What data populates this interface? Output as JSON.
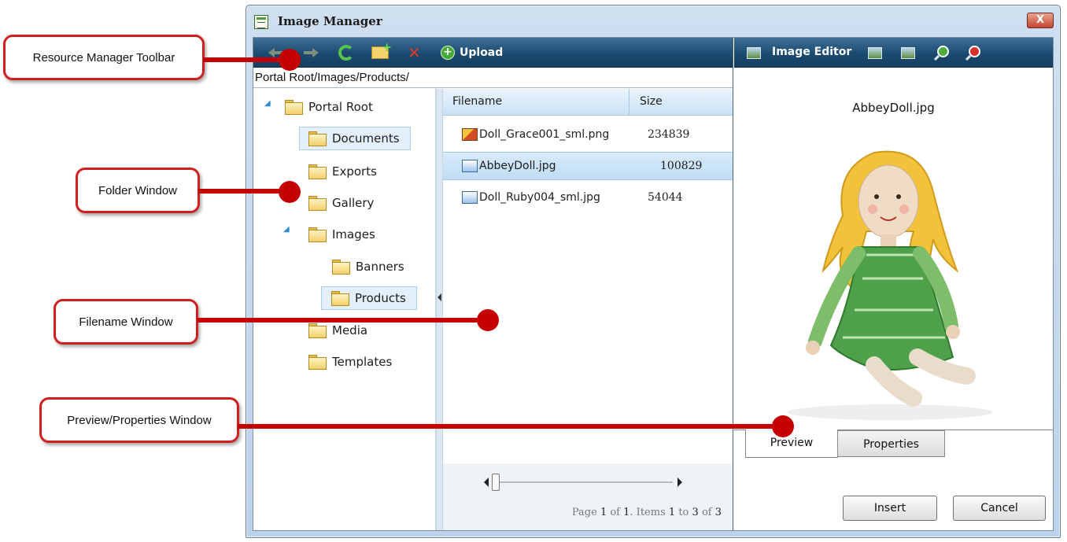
{
  "window": {
    "title": "Image Manager",
    "close_glyph": "X"
  },
  "toolbar": {
    "upload_label": "Upload",
    "icons": [
      "back-arrow-icon",
      "forward-arrow-icon",
      "refresh-icon",
      "new-folder-icon",
      "delete-icon",
      "upload-icon"
    ]
  },
  "path": "Portal Root/Images/Products/",
  "folders": [
    {
      "label": "Portal Root",
      "expander": "◢"
    },
    {
      "label": "Documents"
    },
    {
      "label": "Exports"
    },
    {
      "label": "Gallery",
      "expander": "▷"
    },
    {
      "label": "Images",
      "expander": "◢"
    },
    {
      "label": "Banners"
    },
    {
      "label": "Products"
    },
    {
      "label": "Media"
    },
    {
      "label": "Templates"
    }
  ],
  "grid": {
    "columns": [
      "Filename",
      "Size"
    ],
    "rows": [
      {
        "name": "Doll_Grace001_sml.png",
        "size": "234839"
      },
      {
        "name": "AbbeyDoll.jpg",
        "size": "100829"
      },
      {
        "name": "Doll_Ruby004_sml.jpg",
        "size": "54044"
      }
    ],
    "pager": {
      "prefix": "Page",
      "page": "1",
      "of": "of",
      "pages": "1",
      "items_prefix": ". Items",
      "from": "1",
      "to_word": "to",
      "to": "3",
      "of2": "of",
      "total": "3"
    }
  },
  "editor": {
    "label": "Image Editor",
    "preview_filename": "AbbeyDoll.jpg",
    "tabs": [
      "Preview",
      "Properties"
    ],
    "buttons": {
      "insert": "Insert",
      "cancel": "Cancel"
    }
  },
  "callouts": {
    "toolbar": "Resource Manager Toolbar",
    "folder": "Folder Window",
    "filename": "Filename Window",
    "preview": "Preview/Properties Window"
  },
  "colors": {
    "callout_red": "#c40000",
    "toolbar_blue": "#1c4b70",
    "selection_blue": "#c9e2f6"
  }
}
